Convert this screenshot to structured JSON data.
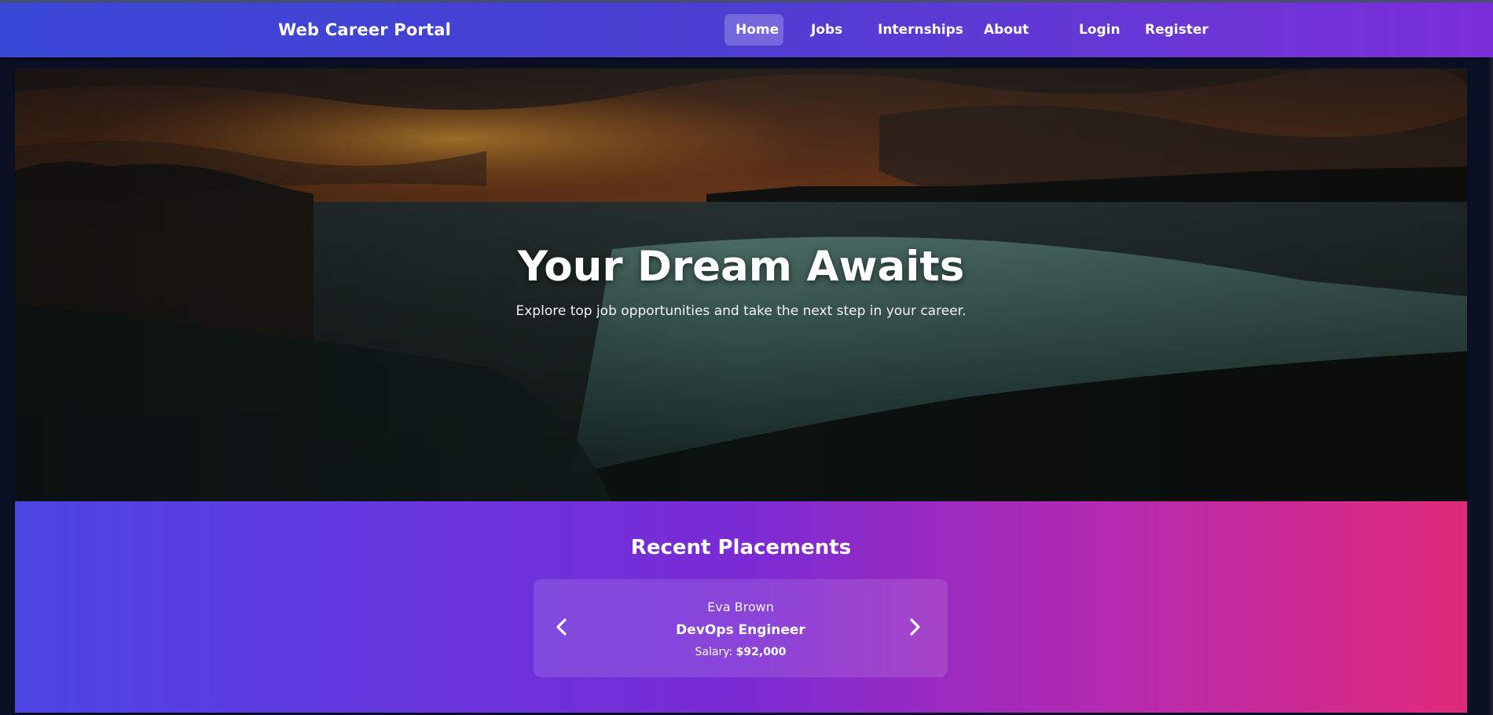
{
  "navbar": {
    "brand": "Web Career Portal",
    "items": [
      {
        "label": "Home",
        "active": true
      },
      {
        "label": "Jobs",
        "active": false
      },
      {
        "label": "Internships",
        "active": false
      },
      {
        "label": "About",
        "active": false
      },
      {
        "label": "Login",
        "active": false
      },
      {
        "label": "Register",
        "active": false
      }
    ]
  },
  "hero": {
    "title": "Your Dream Awaits",
    "subtitle": "Explore top job opportunities and take the next step in your career."
  },
  "placements": {
    "title": "Recent Placements",
    "current": {
      "name": "Eva Brown",
      "role": "DevOps Engineer",
      "salary_label": "Salary:",
      "salary_value": "$92,000"
    },
    "prev_icon": "chevron-left-icon",
    "next_icon": "chevron-right-icon"
  },
  "colors": {
    "nav_start": "#3a48d6",
    "nav_end": "#7b2ed8",
    "section_start": "#4b45e3",
    "section_end": "#e02a7a",
    "page_bg": "#0b0f24"
  }
}
